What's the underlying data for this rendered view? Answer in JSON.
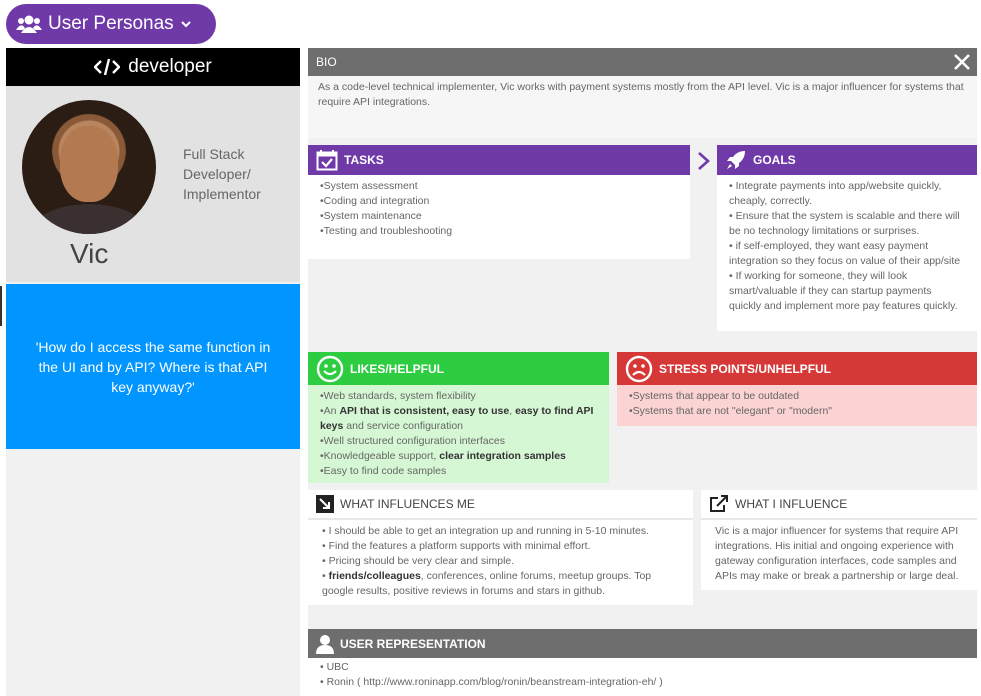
{
  "app": {
    "menu_label": "User Personas"
  },
  "persona": {
    "role": "developer",
    "title_lines": [
      "Full Stack",
      "Developer/",
      "Implementor"
    ],
    "name": "Vic",
    "quote": "'How do I access the same function in the UI and by API? Where is that API key anyway?'"
  },
  "bio": {
    "header": "BIO",
    "text": "As a code-level technical implementer, Vic works with payment systems mostly from the API level. Vic is a major influencer for systems that require API integrations."
  },
  "tasks": {
    "header": "TASKS",
    "items": [
      "•System assessment",
      "•Coding and integration",
      "•System maintenance",
      "•Testing and troubleshooting"
    ]
  },
  "goals": {
    "header": "GOALS",
    "items": [
      "• Integrate payments into app/website quickly, cheaply, correctly.",
      "•  Ensure that the system is scalable and there will be no technology limitations or surprises.",
      "• if self-employed, they want easy payment integration so they focus on value of their app/site",
      "• If working for someone, they will look smart/valuable if they can startup payments quickly and implement more pay features quickly."
    ]
  },
  "likes": {
    "header": "LIKES/HELPFUL",
    "item1": "•Web standards, system flexibility",
    "item2_pre": "•An ",
    "item2_b1": "API that is consistent, easy to use",
    "item2_mid": ", ",
    "item2_b2": "easy to find API keys",
    "item2_post": " and service configuration",
    "item3": "•Well structured configuration interfaces",
    "item4_pre": "•Knowledgeable support, ",
    "item4_b": "clear integration samples",
    "item5": "•Easy to find code samples"
  },
  "stress": {
    "header": "STRESS POINTS/UNHELPFUL",
    "items": [
      "•Systems that appear to be outdated",
      "•Systems that are not \"elegant\" or \"modern\""
    ]
  },
  "influences_me": {
    "header": "WHAT INFLUENCES ME",
    "item1": "• I should be able to get an integration up and running in 5-10 minutes.",
    "item2": "• Find the features a platform supports with minimal effort.",
    "item3": "• Pricing should be very clear and simple.",
    "item4_pre": "• ",
    "item4_b": "friends/colleagues",
    "item4_post": ", conferences, online forums, meetup groups. Top google results, positive reviews in forums and stars in github."
  },
  "i_influence": {
    "header": "WHAT I INFLUENCE",
    "text": "Vic is a major influencer for systems that require API integrations.  His initial and ongoing experience with gateway configuration interfaces, code samples and APIs may make or break a partnership or large deal."
  },
  "user_rep": {
    "header": "USER REPRESENTATION",
    "items": [
      "• UBC",
      "• Ronin ( http://www.roninapp.com/blog/ronin/beanstream-integration-eh/ )"
    ]
  },
  "colors": {
    "purple": "#6f3aa8",
    "blue": "#0095ff",
    "green": "#2ecc40",
    "red": "#d63838",
    "gray_header": "#6e6e6e"
  }
}
